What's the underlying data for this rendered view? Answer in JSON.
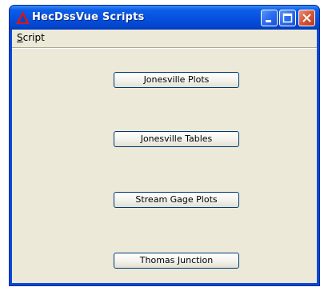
{
  "window": {
    "title": "HecDssVue Scripts"
  },
  "menubar": {
    "items": [
      {
        "label": "Script"
      }
    ]
  },
  "buttons": [
    {
      "label": "Jonesville Plots"
    },
    {
      "label": "Jonesville Tables"
    },
    {
      "label": "Stream Gage Plots"
    },
    {
      "label": "Thomas Junction"
    }
  ],
  "colors": {
    "titlebar": "#0550de",
    "client_background": "#ece9d8",
    "close_button": "#d85a3c",
    "button_border": "#003c74"
  },
  "icons": {
    "app": "red-triangle-icon",
    "minimize": "minimize-icon",
    "maximize": "maximize-icon",
    "close": "close-icon"
  }
}
